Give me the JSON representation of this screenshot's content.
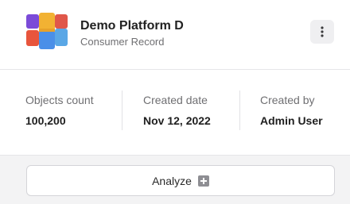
{
  "header": {
    "title": "Demo Platform D",
    "subtitle": "Consumer Record",
    "logo_icon": "cube-logo-icon",
    "menu_icon": "kebab-menu-icon"
  },
  "stats": [
    {
      "label": "Objects count",
      "value": "100,200"
    },
    {
      "label": "Created date",
      "value": "Nov 12, 2022"
    },
    {
      "label": "Created by",
      "value": "Admin User"
    }
  ],
  "action": {
    "label": "Analyze",
    "icon": "plus-square-icon"
  },
  "colors": {
    "card_bg": "#ffffff",
    "page_bg": "#f3f3f4",
    "muted_text": "#6f6f72",
    "icon_gray": "#8e8e93"
  }
}
